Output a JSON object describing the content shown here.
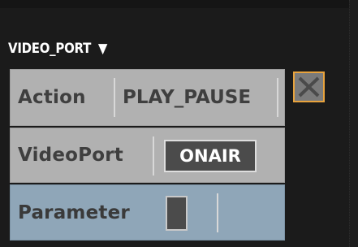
{
  "node": {
    "title": "VIDEO_PORT",
    "toggle_glyph": "▼"
  },
  "rows": [
    {
      "label": "Action",
      "value": "PLAY_PAUSE"
    },
    {
      "label": "VideoPort",
      "value": "ONAIR"
    },
    {
      "label": "Parameter",
      "value": ""
    }
  ],
  "icons": {
    "toggle": "triangle-down-icon",
    "close": "close-icon"
  },
  "colors": {
    "background": "#1b1b1b",
    "row_gray": "#b1b1b1",
    "row_blue": "#8fa6b8",
    "button_dark": "#4b4b4b",
    "close_border": "#e8a33d"
  }
}
